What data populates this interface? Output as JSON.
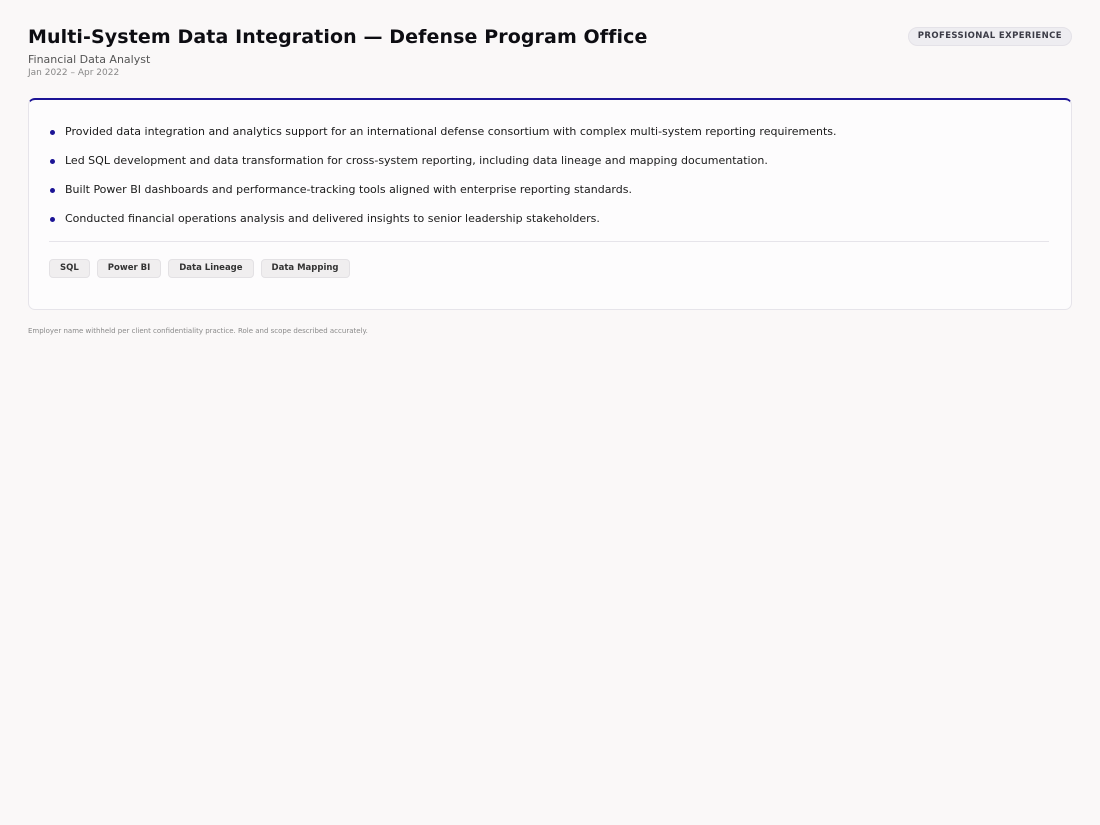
{
  "header": {
    "title": "Multi-System Data Integration — Defense Program Office",
    "role": "Financial Data Analyst",
    "dates": "Jan 2022 – Apr 2022",
    "badge": "PROFESSIONAL EXPERIENCE"
  },
  "card": {
    "accent_color": "#1c1496",
    "bullets": [
      "Provided data integration and analytics support for an international defense consortium with complex multi-system reporting requirements.",
      "Led SQL development and data transformation for cross-system reporting, including data lineage and mapping documentation.",
      "Built Power BI dashboards and performance-tracking tools aligned with enterprise reporting standards.",
      "Conducted financial operations analysis and delivered insights to senior leadership stakeholders."
    ],
    "tags": [
      "SQL",
      "Power BI",
      "Data Lineage",
      "Data Mapping"
    ]
  },
  "footnote": "Employer name withheld per client confidentiality practice. Role and scope described accurately."
}
